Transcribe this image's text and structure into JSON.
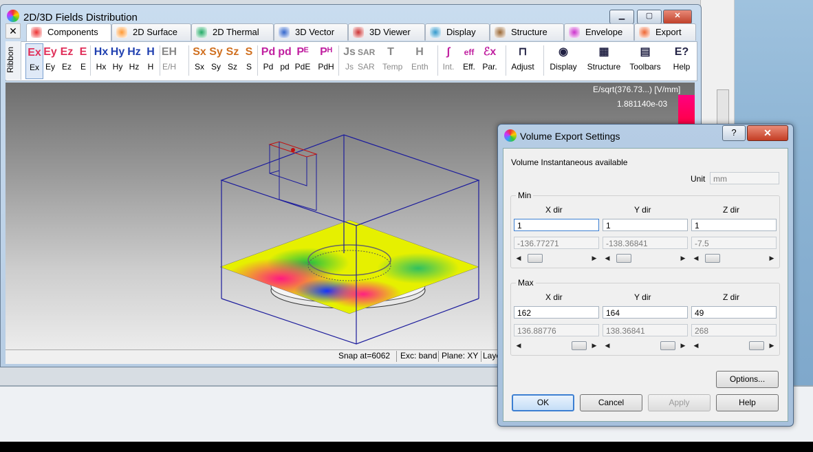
{
  "main_window": {
    "title": "2D/3D Fields Distribution",
    "controls": {
      "minimize": "▁",
      "maximize": "▢",
      "close": "✕"
    }
  },
  "ribbon_close": "✕",
  "ribbon_side_label": "Ribbon",
  "tabs": [
    {
      "label": "Components",
      "icon": "components-icon"
    },
    {
      "label": "2D Surface",
      "icon": "surface-icon"
    },
    {
      "label": "2D Thermal",
      "icon": "thermal-icon"
    },
    {
      "label": "3D Vector",
      "icon": "vector-icon"
    },
    {
      "label": "3D Viewer",
      "icon": "viewer-icon"
    },
    {
      "label": "Display",
      "icon": "display-icon"
    },
    {
      "label": "Structure",
      "icon": "structure-icon"
    },
    {
      "label": "Envelope",
      "icon": "envelope-icon"
    },
    {
      "label": "Export",
      "icon": "export-icon"
    }
  ],
  "ribbon_buttons": [
    {
      "icon": "Ex",
      "label": "Ex"
    },
    {
      "icon": "Ey",
      "label": "Ey"
    },
    {
      "icon": "Ez",
      "label": "Ez"
    },
    {
      "icon": "E",
      "label": "E"
    },
    {
      "icon": "Hx",
      "label": "Hx"
    },
    {
      "icon": "Hy",
      "label": "Hy"
    },
    {
      "icon": "Hz",
      "label": "Hz"
    },
    {
      "icon": "H",
      "label": "H"
    },
    {
      "icon": "EH",
      "label": "E/H"
    },
    {
      "icon": "Sx",
      "label": "Sx"
    },
    {
      "icon": "Sy",
      "label": "Sy"
    },
    {
      "icon": "Sz",
      "label": "Sz"
    },
    {
      "icon": "S",
      "label": "S"
    },
    {
      "icon": "Pd",
      "label": "Pd"
    },
    {
      "icon": "pd",
      "label": "pd"
    },
    {
      "icon": "Pᴱ",
      "label": "PdE"
    },
    {
      "icon": "Pᴴ",
      "label": "PdH"
    },
    {
      "icon": "Js",
      "label": "Js"
    },
    {
      "icon": "SAR",
      "label": "SAR"
    },
    {
      "icon": "T",
      "label": "Temp"
    },
    {
      "icon": "H",
      "label": "Enth"
    },
    {
      "icon": "∫",
      "label": "Int."
    },
    {
      "icon": "eff",
      "label": "Eff."
    },
    {
      "icon": "ℰx",
      "label": "Par."
    },
    {
      "icon": "⊓",
      "label": "Adjust"
    },
    {
      "icon": "◉",
      "label": "Display"
    },
    {
      "icon": "▦",
      "label": "Structure"
    },
    {
      "icon": "▤",
      "label": "Toolbars"
    },
    {
      "icon": "E?",
      "label": "Help"
    }
  ],
  "colors": {
    "accent": "#3c7fd2",
    "e_red": "#e0305a",
    "h_blue": "#2040b0",
    "s_orange": "#d07020",
    "p_magenta": "#c020a0"
  },
  "legend": {
    "title": "E/sqrt(376.73...) [V/mm]",
    "max_value": "1.881140e-03"
  },
  "status_bar": {
    "snap": "Snap at=6062",
    "exc": "Exc: band",
    "plane": "Plane: XY",
    "layer": "Laye"
  },
  "dialog": {
    "title": "Volume Export Settings",
    "help_button": "?",
    "close_button": "✕",
    "info": "Volume Instantaneous available",
    "unit_label": "Unit",
    "unit_value": "mm",
    "min": {
      "group_label": "Min",
      "headers": [
        "X dir",
        "Y dir",
        "Z dir"
      ],
      "inputs": [
        "1",
        "1",
        "1"
      ],
      "readouts": [
        "-136.77271",
        "-138.36841",
        "-7.5"
      ],
      "scroll_positions": [
        0.08,
        0.08,
        0.08
      ]
    },
    "max": {
      "group_label": "Max",
      "headers": [
        "X dir",
        "Y dir",
        "Z dir"
      ],
      "inputs": [
        "162",
        "164",
        "49"
      ],
      "readouts": [
        "136.88776",
        "138.36841",
        "268"
      ],
      "scroll_positions": [
        0.92,
        0.92,
        0.92
      ]
    },
    "buttons": {
      "options": "Options...",
      "ok": "OK",
      "cancel": "Cancel",
      "apply": "Apply",
      "help": "Help"
    }
  }
}
